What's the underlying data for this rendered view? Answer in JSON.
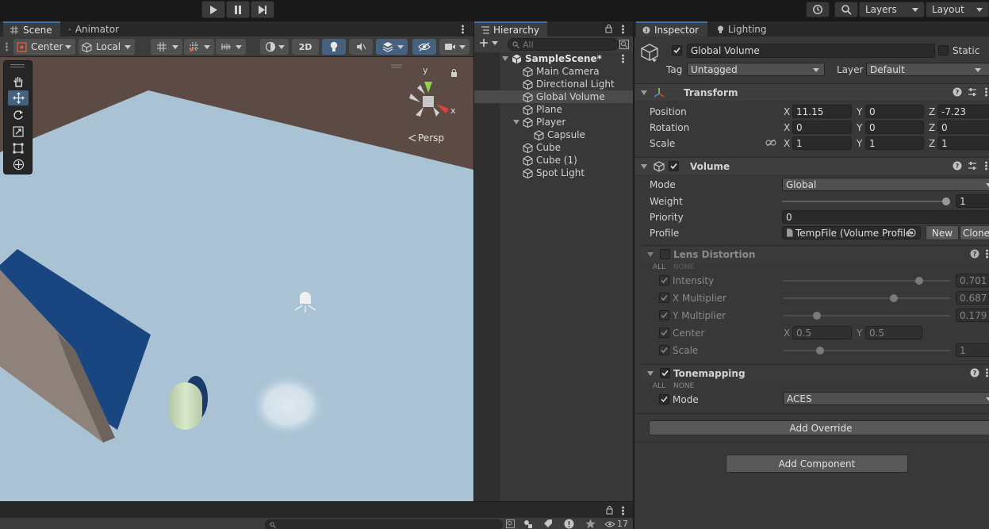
{
  "topbar": {
    "layers_label": "Layers",
    "layout_label": "Layout"
  },
  "scene_panel": {
    "tabs": [
      {
        "label": "Scene",
        "active": true
      },
      {
        "label": "Animator",
        "active": false
      }
    ],
    "pivot_mode": "Center",
    "pivot_rotation": "Local",
    "view_2d": "2D",
    "projection_label": "Persp",
    "gizmo_axes": {
      "x": "x",
      "y": "y"
    }
  },
  "hierarchy": {
    "tab_label": "Hierarchy",
    "search_placeholder": "All",
    "scene_name": "SampleScene*",
    "items": [
      {
        "label": "Main Camera",
        "depth": 1,
        "selected": false
      },
      {
        "label": "Directional Light",
        "depth": 1,
        "selected": false
      },
      {
        "label": "Global Volume",
        "depth": 1,
        "selected": true
      },
      {
        "label": "Plane",
        "depth": 1,
        "selected": false
      },
      {
        "label": "Player",
        "depth": 1,
        "selected": false,
        "expanded": true
      },
      {
        "label": "Capsule",
        "depth": 2,
        "selected": false
      },
      {
        "label": "Cube",
        "depth": 1,
        "selected": false
      },
      {
        "label": "Cube (1)",
        "depth": 1,
        "selected": false
      },
      {
        "label": "Spot Light",
        "depth": 1,
        "selected": false
      }
    ]
  },
  "inspector": {
    "tabs": [
      {
        "label": "Inspector",
        "active": true
      },
      {
        "label": "Lighting",
        "active": false
      }
    ],
    "object_name": "Global Volume",
    "static_label": "Static",
    "tag_label": "Tag",
    "tag_value": "Untagged",
    "layer_label": "Layer",
    "layer_value": "Default",
    "transform": {
      "title": "Transform",
      "position_label": "Position",
      "rotation_label": "Rotation",
      "scale_label": "Scale",
      "axis_x": "X",
      "axis_y": "Y",
      "axis_z": "Z",
      "position": {
        "x": "11.15",
        "y": "0",
        "z": "-7.23"
      },
      "rotation": {
        "x": "0",
        "y": "0",
        "z": "0"
      },
      "scale": {
        "x": "1",
        "y": "1",
        "z": "1"
      }
    },
    "volume": {
      "title": "Volume",
      "mode_label": "Mode",
      "mode_value": "Global",
      "weight_label": "Weight",
      "weight_value": "1",
      "weight_fraction": 1.0,
      "priority_label": "Priority",
      "priority_value": "0",
      "profile_label": "Profile",
      "profile_value": "TempFile (Volume Profile",
      "new_label": "New",
      "clone_label": "Clone"
    },
    "lens_distortion": {
      "title": "Lens Distortion",
      "all_label": "ALL",
      "none_label": "NONE",
      "intensity_label": "Intensity",
      "intensity_value": "0.701",
      "intensity_fraction": 0.83,
      "xmult_label": "X Multiplier",
      "xmult_value": "0.687",
      "xmult_fraction": 0.67,
      "ymult_label": "Y Multiplier",
      "ymult_value": "0.179",
      "ymult_fraction": 0.19,
      "center_label": "Center",
      "center_x": "0.5",
      "center_y": "0.5",
      "scale_label": "Scale",
      "scale_value": "1",
      "scale_fraction": 0.21
    },
    "tonemapping": {
      "title": "Tonemapping",
      "all_label": "ALL",
      "none_label": "NONE",
      "mode_label": "Mode",
      "mode_value": "ACES"
    },
    "add_override_label": "Add Override",
    "add_component_label": "Add Component"
  },
  "bottom": {
    "count_badge": "17"
  },
  "colors": {
    "accent": "#3a72b0",
    "selected_tool": "#46607f",
    "panel_bg": "#383838",
    "floor": "#a9c3d5",
    "background_wall": "#5c4b44",
    "cube_blue": "#194681"
  }
}
